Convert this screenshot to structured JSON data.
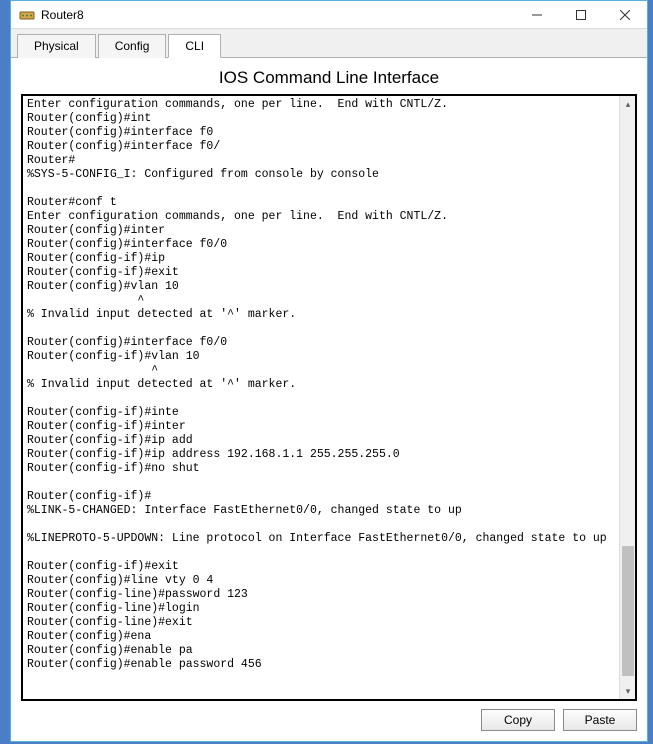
{
  "window": {
    "title": "Router8"
  },
  "tabs": {
    "physical": "Physical",
    "config": "Config",
    "cli": "CLI"
  },
  "cli": {
    "heading": "IOS Command Line Interface",
    "output": "Enter configuration commands, one per line.  End with CNTL/Z.\nRouter(config)#int\nRouter(config)#interface f0\nRouter(config)#interface f0/\nRouter#\n%SYS-5-CONFIG_I: Configured from console by console\n\nRouter#conf t\nEnter configuration commands, one per line.  End with CNTL/Z.\nRouter(config)#inter\nRouter(config)#interface f0/0\nRouter(config-if)#ip\nRouter(config-if)#exit\nRouter(config)#vlan 10\n                ^\n% Invalid input detected at '^' marker.\n\nRouter(config)#interface f0/0\nRouter(config-if)#vlan 10\n                  ^\n% Invalid input detected at '^' marker.\n\nRouter(config-if)#inte\nRouter(config-if)#inter\nRouter(config-if)#ip add\nRouter(config-if)#ip address 192.168.1.1 255.255.255.0\nRouter(config-if)#no shut\n\nRouter(config-if)#\n%LINK-5-CHANGED: Interface FastEthernet0/0, changed state to up\n\n%LINEPROTO-5-UPDOWN: Line protocol on Interface FastEthernet0/0, changed state to up\n\nRouter(config-if)#exit\nRouter(config)#line vty 0 4\nRouter(config-line)#password 123\nRouter(config-line)#login\nRouter(config-line)#exit\nRouter(config)#ena\nRouter(config)#enable pa\nRouter(config)#enable password 456"
  },
  "buttons": {
    "copy": "Copy",
    "paste": "Paste"
  }
}
